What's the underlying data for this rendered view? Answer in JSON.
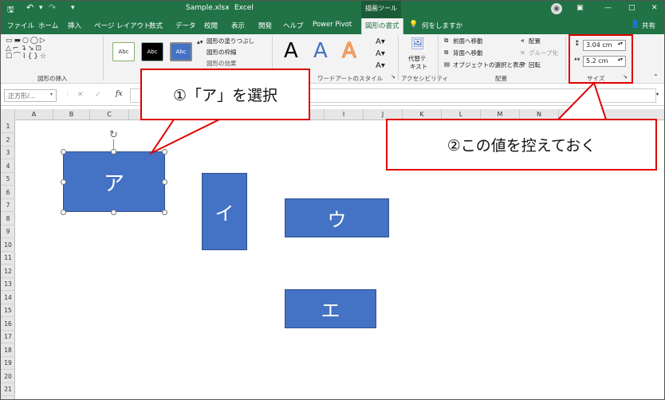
{
  "titlebar": {
    "filename": "Sample.xlsx",
    "separator": "-",
    "app": "Excel",
    "context_tool": "描画ツール",
    "win_min": "—",
    "win_max": "□",
    "win_close": "✕"
  },
  "tabs": [
    "ファイル",
    "ホーム",
    "挿入",
    "ページ レイアウト",
    "数式",
    "データ",
    "校閲",
    "表示",
    "開発",
    "ヘルプ",
    "Power Pivot",
    "図形の書式"
  ],
  "tell_me": "何をしますか",
  "share": "共有",
  "ribbon": {
    "insert_shapes_label": "図形の挿入",
    "style_sample": "Abc",
    "shape_fill": "図形の塗りつぶし",
    "shape_outline": "図形の枠線",
    "shape_effects": "図形の効果",
    "wordart_label": "ワードアートのスタイル",
    "wordart_letter": "A",
    "alt_text_line1": "代替テ",
    "alt_text_line2": "キスト",
    "accessibility_label": "アクセシビリティ",
    "bring_forward": "前面へ移動",
    "send_backward": "背面へ移動",
    "selection_pane": "オブジェクトの選択と表示",
    "align": "配置",
    "group": "グループ化",
    "rotate": "回転",
    "arrange_label": "配置",
    "height_value": "3.04 cm",
    "width_value": "5.2 cm",
    "size_label": "サイズ"
  },
  "formula_bar": {
    "name_box": "正方形/..."
  },
  "columns": [
    "A",
    "B",
    "C",
    "D",
    "E",
    "F",
    "G",
    "H",
    "I",
    "J",
    "K",
    "L",
    "M",
    "N",
    "O"
  ],
  "rows": [
    "1",
    "2",
    "3",
    "4",
    "5",
    "6",
    "7",
    "8",
    "9",
    "10",
    "11",
    "12",
    "13",
    "14",
    "15",
    "16",
    "17",
    "18",
    "19",
    "20",
    "21"
  ],
  "shapes": {
    "a": "ア",
    "i": "イ",
    "u": "ウ",
    "e": "エ"
  },
  "callouts": {
    "step1": "①「ア」を選択",
    "step2": "②この値を控えておく"
  },
  "colors": {
    "excel_green": "#217346",
    "shape_blue": "#4472c4",
    "callout_red": "#e00000"
  }
}
